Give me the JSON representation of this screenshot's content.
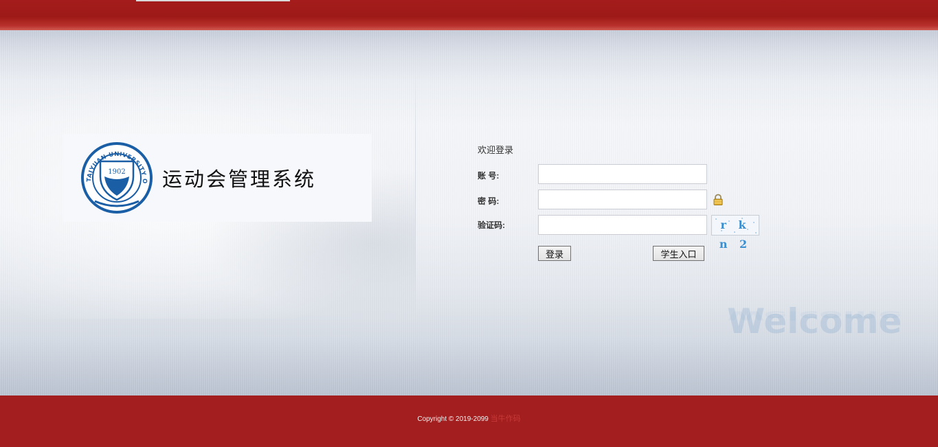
{
  "header": {
    "bar_color": "#9d1917"
  },
  "branding": {
    "seal_year": "1902",
    "seal_text": "TAIYUAN UNIVERSITY OF TECHNOLOGY",
    "system_title": "运动会管理系统"
  },
  "login": {
    "heading": "欢迎登录",
    "account_label": "账 号:",
    "account_value": "",
    "password_label": "密 码:",
    "password_value": "",
    "captcha_label": "验证码:",
    "captcha_value": "",
    "captcha_image_text": "r k n 2",
    "login_button": "登录",
    "student_button": "学生入口"
  },
  "watermark": {
    "text": "Welcome"
  },
  "footer": {
    "copyright": "Copyright © 2019-2099",
    "link_text": "当牛作码",
    "color": "#a31e1e"
  }
}
